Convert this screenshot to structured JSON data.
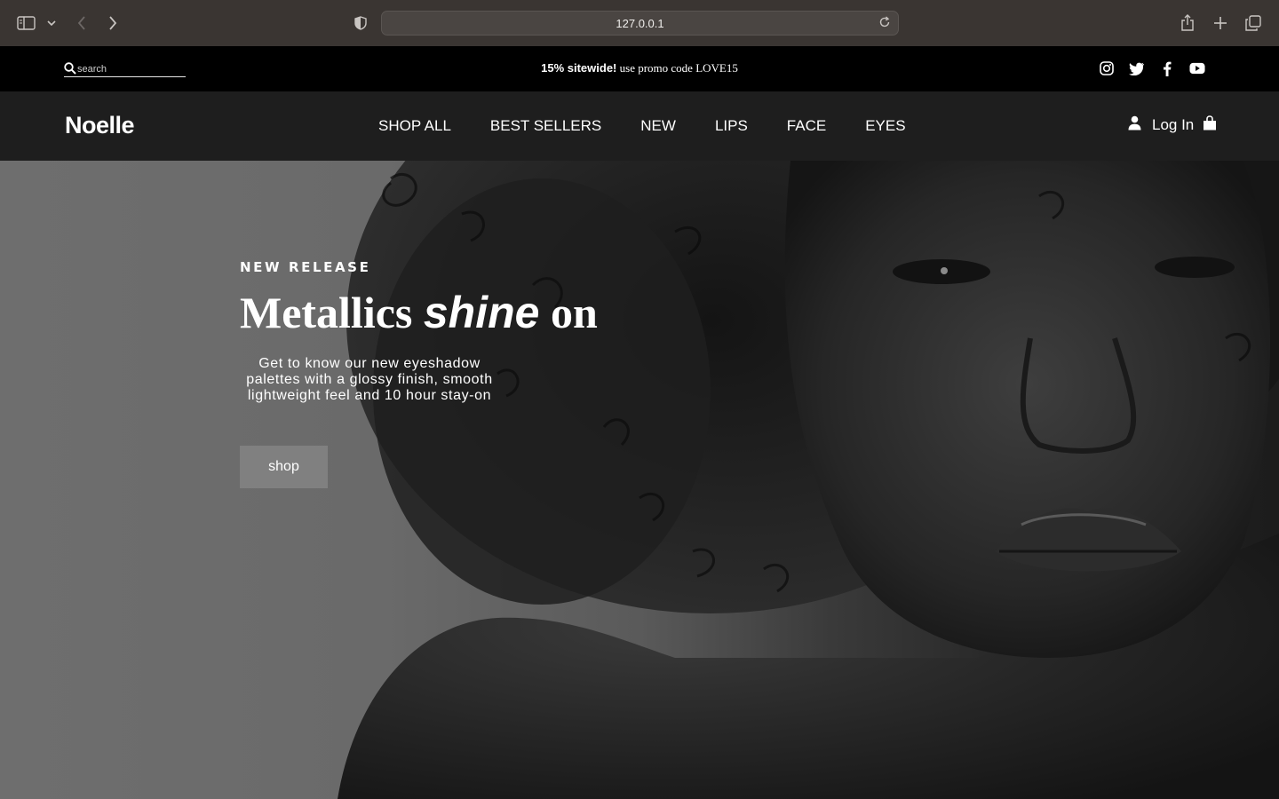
{
  "browser": {
    "url": "127.0.0.1"
  },
  "promo": {
    "search_placeholder": "search",
    "promo_bold": "15% sitewide!",
    "promo_rest": " use promo code LOVE15"
  },
  "nav": {
    "logo": "Noelle",
    "links": [
      "SHOP ALL",
      "BEST SELLERS",
      "NEW",
      "LIPS",
      "FACE",
      "EYES"
    ],
    "login": "Log In"
  },
  "hero": {
    "eyebrow": "NEW RELEASE",
    "headline_1": "Metallics ",
    "headline_em": "shine",
    "headline_2": " on",
    "description": "Get to know our new eyeshadow palettes with a glossy finish, smooth lightweight feel and 10 hour stay-on",
    "button": "shop"
  }
}
